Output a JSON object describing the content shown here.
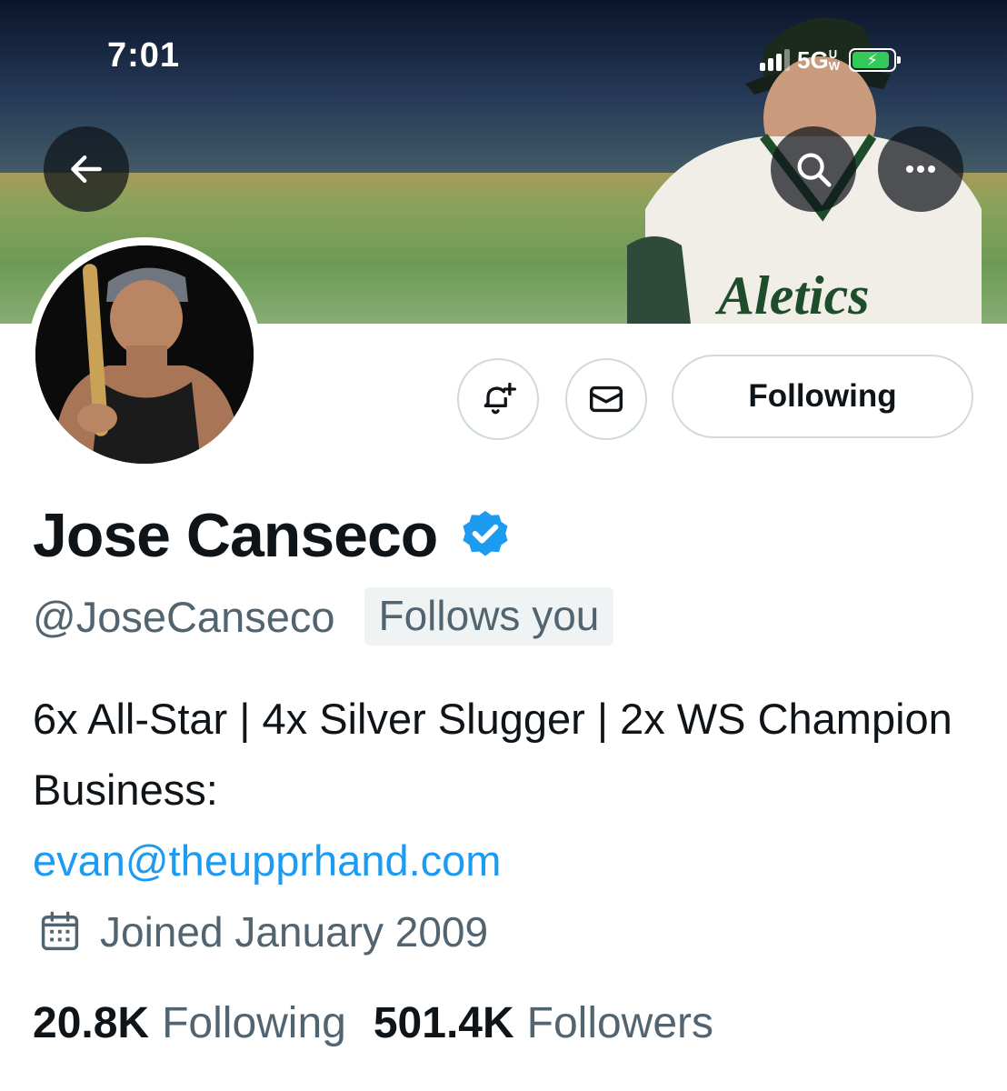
{
  "status_bar": {
    "time": "7:01",
    "network": "5G",
    "network_sub": "UW"
  },
  "header": {
    "back_icon": "arrow-left-icon",
    "search_icon": "search-icon",
    "more_icon": "more-horizontal-icon"
  },
  "actions": {
    "notify_icon": "bell-plus-icon",
    "message_icon": "envelope-icon",
    "following_label": "Following"
  },
  "profile": {
    "name": "Jose Canseco",
    "verified": true,
    "handle": "@JoseCanseco",
    "follows_you": "Follows you",
    "bio_text": "6x All-Star | 4x Silver Slugger | 2x WS Champion Business:",
    "bio_link": "evan@theupprhand.com",
    "joined": "Joined January 2009",
    "following_count": "20.8K",
    "following_label": "Following",
    "followers_count": "501.4K",
    "followers_label": "Followers"
  },
  "colors": {
    "accent": "#1d9bf0",
    "text": "#0f1419",
    "secondary": "#536471",
    "border": "#cfd9de"
  }
}
